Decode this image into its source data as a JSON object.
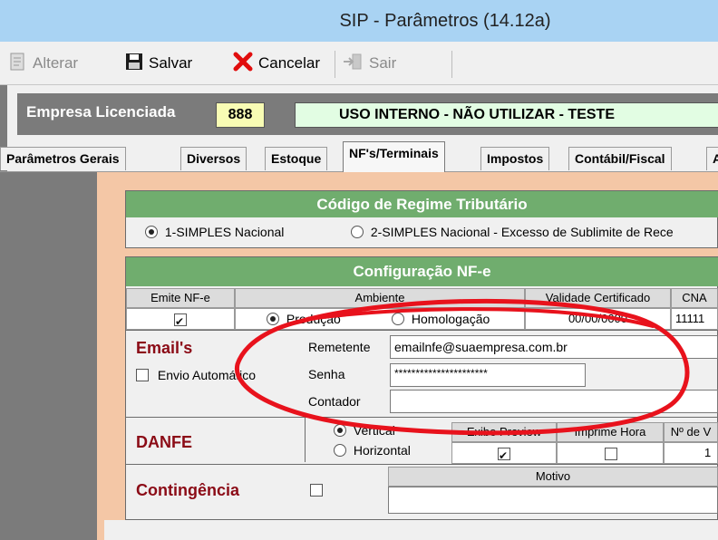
{
  "window": {
    "title": "SIP - Parâmetros  (14.12a)"
  },
  "toolbar": {
    "alterar": "Alterar",
    "salvar": "Salvar",
    "cancelar": "Cancelar",
    "sair": "Sair"
  },
  "licensed": {
    "label": "Empresa Licenciada",
    "code": "888",
    "name": "USO INTERNO - NÃO UTILIZAR - TESTE"
  },
  "tabs": [
    "Parâmetros Gerais",
    "Diversos",
    "Estoque",
    "NF's/Terminais",
    "Impostos",
    "Contábil/Fiscal",
    "A"
  ],
  "active_tab": "NF's/Terminais",
  "regime": {
    "title": "Código de Regime Tributário",
    "option1": "1-SIMPLES Nacional",
    "option2": "2-SIMPLES Nacional - Excesso de Sublimite de Rece",
    "selected": "1-SIMPLES Nacional"
  },
  "nfe": {
    "title": "Configuração NF-e",
    "col_emite": "Emite NF-e",
    "col_ambiente": "Ambiente",
    "col_validade": "Validade Certificado",
    "col_cna": "CNA",
    "emite_checked": true,
    "amb_producao": "Produção",
    "amb_homologacao": "Homologação",
    "amb_selected": "Produção",
    "validade": "00/00/0000",
    "cna_value": "11111"
  },
  "email": {
    "title": "Email's",
    "envio_label": "Envio Automático",
    "remetente_label": "Remetente",
    "remetente_value": "emailnfe@suaempresa.com.br",
    "senha_label": "Senha",
    "senha_value": "**********************",
    "contador_label": "Contador",
    "contador_value": ""
  },
  "danfe": {
    "title": "DANFE",
    "vertical": "Vertical",
    "horizontal": "Horizontal",
    "selected": "Vertical",
    "col_exibe": "Exibe Preview",
    "col_imprime": "Imprime Hora",
    "col_vias": "Nº de V",
    "exibe_checked": true,
    "imprime_checked": false,
    "vias_value": "1"
  },
  "contingencia": {
    "title": "Contingência",
    "checked": false,
    "motivo_label": "Motivo",
    "motivo_value": ""
  },
  "annotation": {
    "color": "#e8121c"
  }
}
